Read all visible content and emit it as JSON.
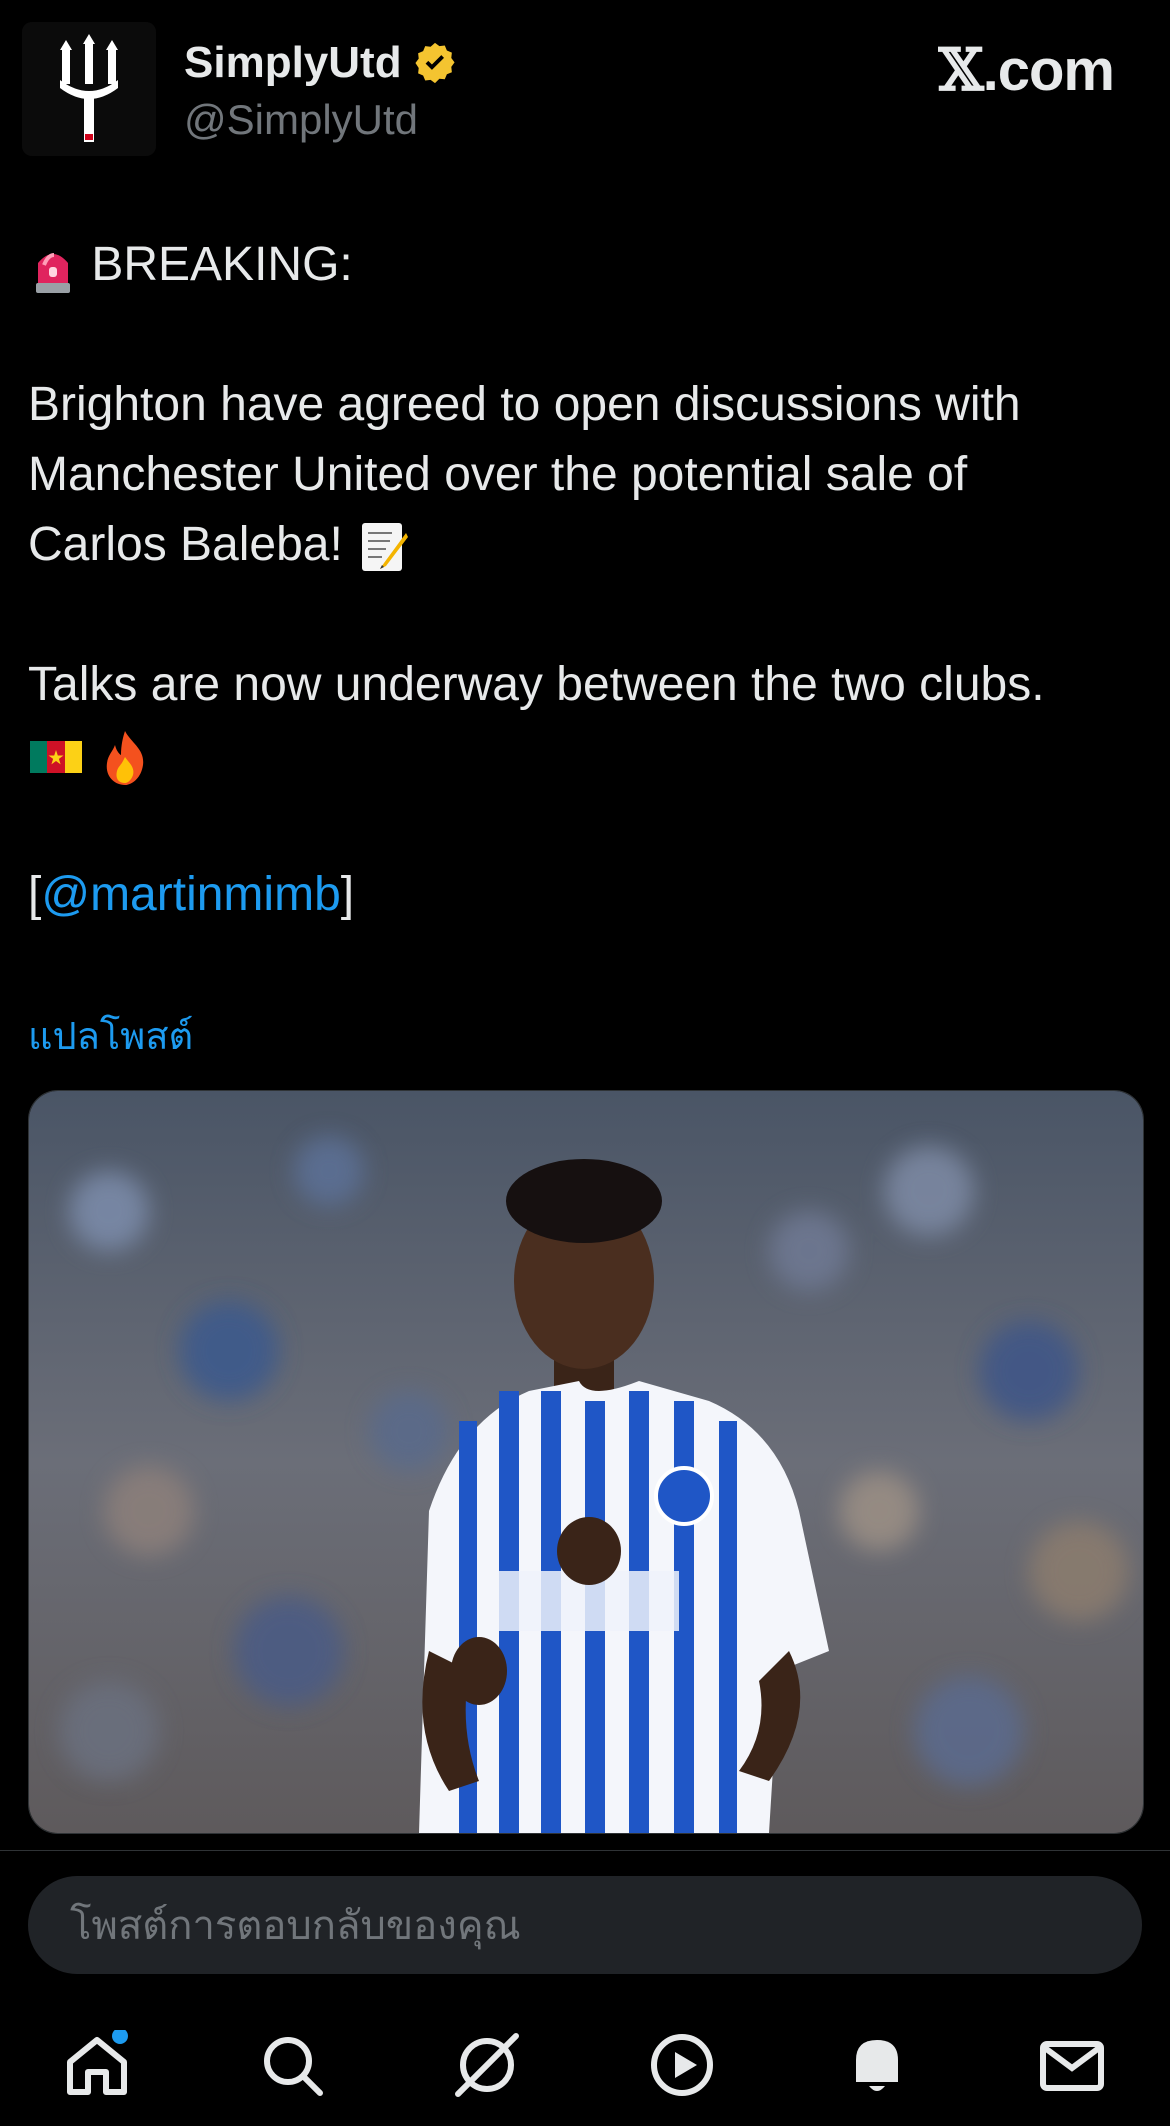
{
  "header": {
    "display_name": "SimplyUtd",
    "handle": "@SimplyUtd",
    "brand": {
      "glyph": "𝕏",
      "suffix": ".com"
    },
    "verified_color": "#f4c430"
  },
  "tweet": {
    "line1": "BREAKING:",
    "para2_l1": "Brighton have agreed to open discussions with",
    "para2_l2": "Manchester United over the potential sale of",
    "para2_l3": "Carlos Baleba!",
    "para3_l1": "Talks are now underway between the two clubs.",
    "open_bracket": "[",
    "mention": "@martinmimb",
    "close_bracket": "]",
    "emojis": [
      "siren-emoji",
      "memo-emoji",
      "cameroon-flag-emoji",
      "fire-emoji"
    ]
  },
  "translate_label": "แปลโพสต์",
  "media": {
    "kind": "photo",
    "icons": [
      "player-photo"
    ]
  },
  "reply": {
    "placeholder": "โพสต์การตอบกลับของคุณ"
  },
  "nav": {
    "items": [
      "home-icon",
      "search-icon",
      "grok-icon",
      "video-icon",
      "notifications-icon",
      "messages-icon"
    ],
    "home_badge_color": "#1d9bf0"
  },
  "colors": {
    "accent": "#1d9bf0",
    "background": "#000000",
    "text": "#e7e9ea",
    "muted": "#71767b"
  }
}
